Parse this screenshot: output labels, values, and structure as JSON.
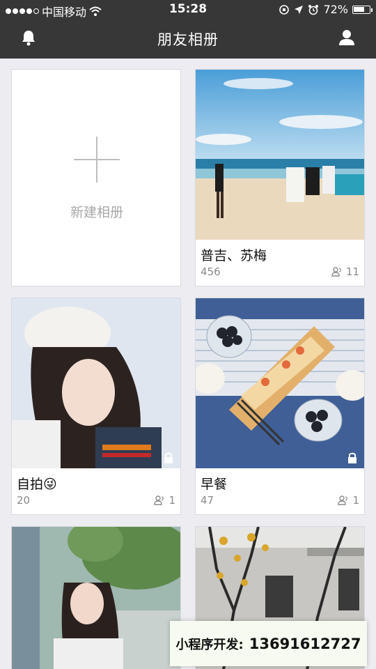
{
  "status_bar": {
    "carrier": "中国移动",
    "time": "15:28",
    "battery": "72%",
    "battery_level": 0.72
  },
  "nav": {
    "title": "朋友相册",
    "left_icon": "bell-icon",
    "right_icon": "person-icon"
  },
  "new_album": {
    "label": "新建相册"
  },
  "albums": [
    {
      "name": "普吉、苏梅",
      "count": "456",
      "members": "11",
      "locked": false
    },
    {
      "name": "自拍😜",
      "count": "20",
      "members": "1",
      "locked": true
    },
    {
      "name": "早餐",
      "count": "47",
      "members": "1",
      "locked": true
    },
    {
      "name": "",
      "count": "",
      "members": "",
      "locked": false
    },
    {
      "name": "",
      "count": "",
      "members": "",
      "locked": false
    }
  ],
  "watermark": {
    "label": "小程序开发:",
    "phone": "13691612727"
  },
  "colors": {
    "topbar": "#373737",
    "background": "#ececf1"
  }
}
